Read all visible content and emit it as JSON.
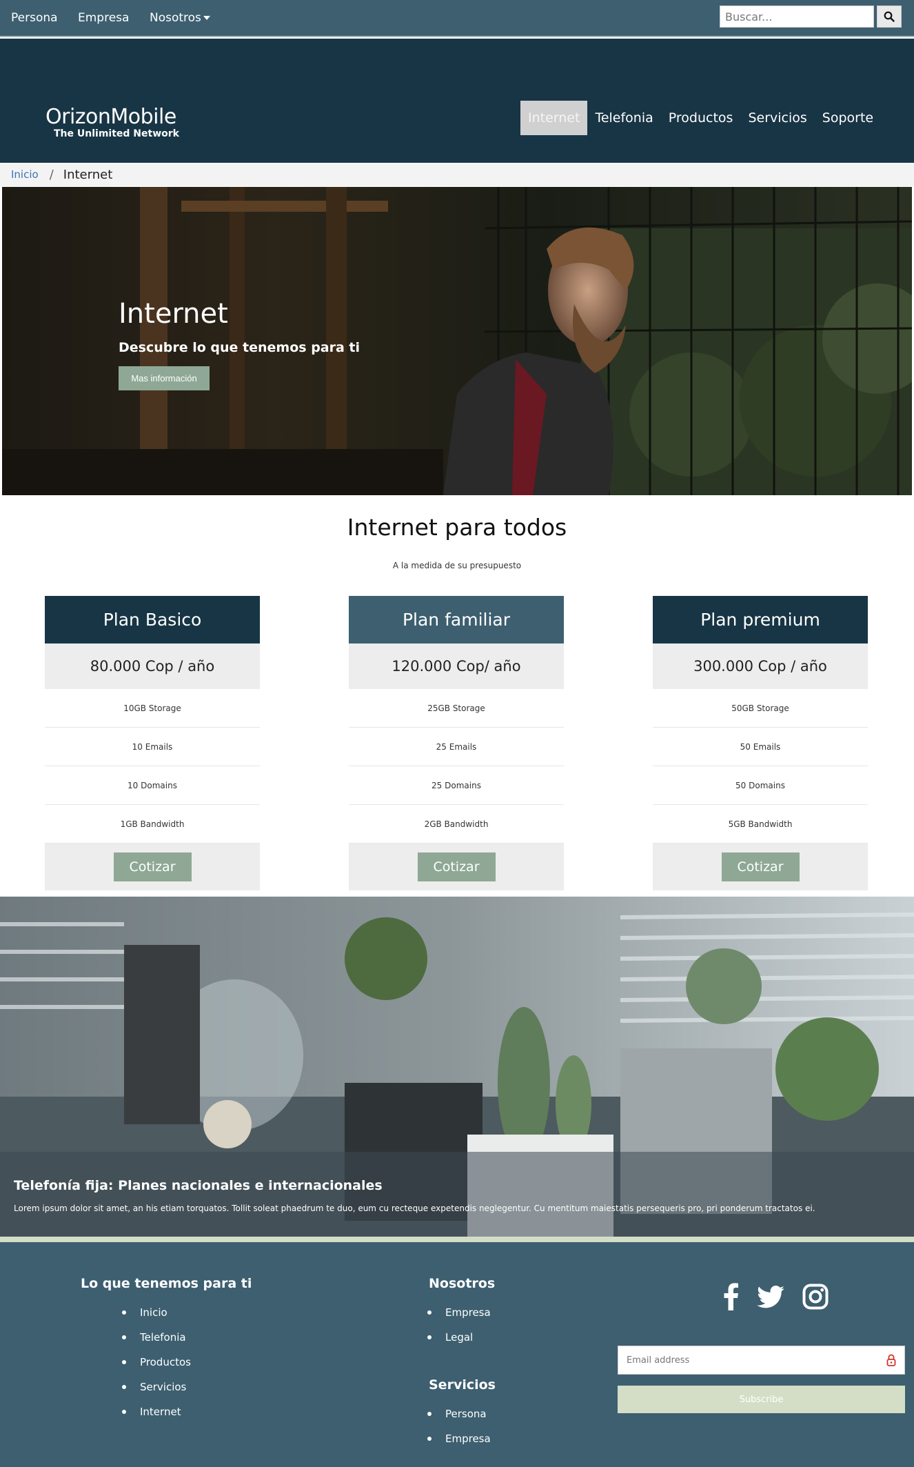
{
  "topbar": {
    "links": [
      "Persona",
      "Empresa",
      "Nosotros"
    ],
    "search_placeholder": "Buscar..."
  },
  "header": {
    "brand": "OrizonMobile",
    "tagline": "The Unlimited Network",
    "nav": [
      "Internet",
      "Telefonia",
      "Productos",
      "Servicios",
      "Soporte"
    ],
    "active_nav": "Internet"
  },
  "breadcrumb": {
    "home": "Inicio",
    "separator": "/",
    "current": "Internet"
  },
  "hero": {
    "title": "Internet",
    "subtitle": "Descubre lo que tenemos para ti",
    "button": "Mas información"
  },
  "plans_section": {
    "title": "Internet para todos",
    "subtitle": "A la medida de su presupuesto",
    "plans": [
      {
        "name": "Plan Basico",
        "price": "80.000 Cop / año",
        "features": [
          "10GB Storage",
          "10 Emails",
          "10 Domains",
          "1GB Bandwidth"
        ],
        "button": "Cotizar",
        "header_color": "#183545"
      },
      {
        "name": "Plan familiar",
        "price": "120.000 Cop/ año",
        "features": [
          "25GB Storage",
          "25 Emails",
          "25 Domains",
          "2GB Bandwidth"
        ],
        "button": "Cotizar",
        "header_color": "#3d5f70"
      },
      {
        "name": "Plan premium",
        "price": "300.000 Cop / año",
        "features": [
          "50GB Storage",
          "50 Emails",
          "50 Domains",
          "5GB Bandwidth"
        ],
        "button": "Cotizar",
        "header_color": "#183545"
      }
    ]
  },
  "banner": {
    "title": "Telefonía fija: Planes nacionales e internacionales",
    "text": "Lorem ipsum dolor sit amet, an his etiam torquatos. Tollit soleat phaedrum te duo, eum cu recteque expetendis neglegentur. Cu mentitum maiestatis persequeris pro, pri ponderum tractatos ei."
  },
  "footer": {
    "col1_title": "Lo que tenemos para ti",
    "col1_items": [
      "Inicio",
      "Telefonia",
      "Productos",
      "Servicios",
      "Internet"
    ],
    "col2_title": "Nosotros",
    "col2_items": [
      "Empresa",
      "Legal"
    ],
    "col3_title": "Servicios",
    "col3_items": [
      "Persona",
      "Empresa"
    ],
    "social_icons": [
      "facebook-icon",
      "twitter-icon",
      "instagram-icon"
    ],
    "email_placeholder": "Email address",
    "subscribe": "Subscribe"
  },
  "colors": {
    "topbar": "#3d5f70",
    "header": "#183545",
    "accent_button": "#8fa895",
    "footer": "#3d5f70",
    "subscribe": "#d4dec6"
  }
}
